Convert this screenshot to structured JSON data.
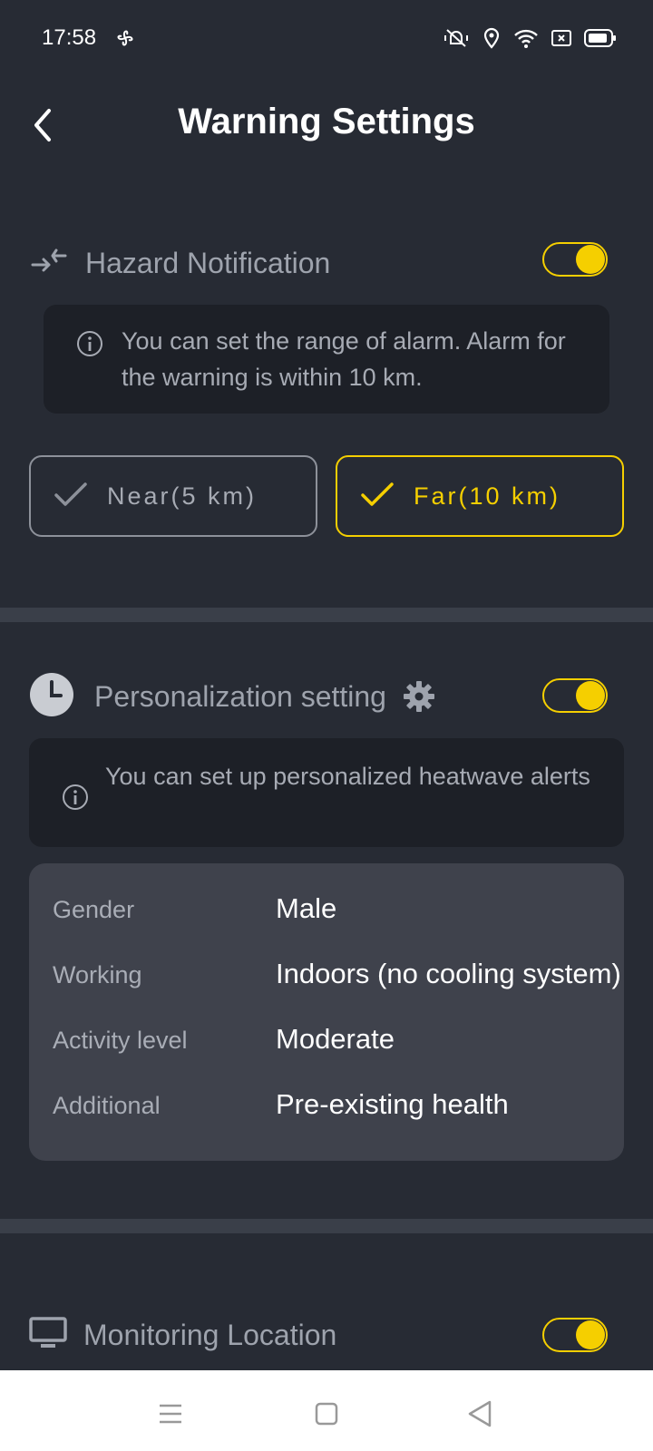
{
  "status": {
    "time": "17:58"
  },
  "header": {
    "title": "Warning Settings"
  },
  "hazard": {
    "title": "Hazard Notification",
    "enabled": true,
    "info": "You can set the range of alarm. Alarm for the warning is within 10 km.",
    "options": [
      {
        "label": "Near(5 km)",
        "selected": false
      },
      {
        "label": "Far(10 km)",
        "selected": true
      }
    ]
  },
  "personalization": {
    "title": "Personalization setting",
    "enabled": true,
    "info": "You can set up personalized heatwave alerts",
    "profile": [
      {
        "key": "Gender",
        "value": "Male"
      },
      {
        "key": "Working",
        "value": "Indoors (no cooling system)"
      },
      {
        "key": "Activity level",
        "value": "Moderate"
      },
      {
        "key": "Additional",
        "value": " Pre-existing health"
      }
    ]
  },
  "monitoring": {
    "title": "Monitoring Location",
    "enabled": true
  },
  "colors": {
    "accent": "#f5cf00",
    "background": "#272b34",
    "card": "#3f424c",
    "info_box": "#1d2027"
  }
}
